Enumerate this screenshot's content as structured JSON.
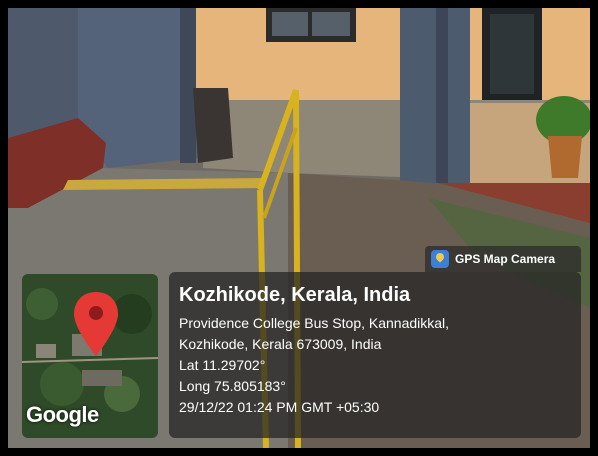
{
  "overlay": {
    "app_badge": "GPS Map Camera",
    "title": "Kozhikode, Kerala, India",
    "address_line1": "Providence College Bus Stop, Kannadikkal,",
    "address_line2": "Kozhikode, Kerala 673009, India",
    "latitude": "Lat 11.29702°",
    "longitude": "Long 75.805183°",
    "datetime": "29/12/22 01:24 PM GMT +05:30",
    "map_brand": "Google"
  },
  "colors": {
    "railing": "#d8b21f",
    "pin": "#e53935",
    "wall": "#e8b77e",
    "pillar": "#4c5a6c"
  }
}
